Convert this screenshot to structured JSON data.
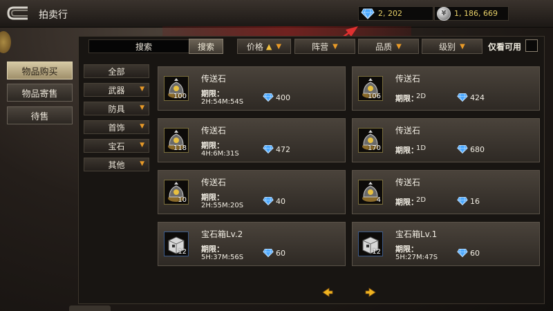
{
  "header": {
    "title": "拍卖行",
    "diamond_balance": "2, 202",
    "silver_balance": "1, 186, 669",
    "silver_coin_glyph": "¥"
  },
  "sidebar": {
    "tabs": [
      {
        "label": "物品购买",
        "active": true
      },
      {
        "label": "物品寄售",
        "active": false
      },
      {
        "label": "待售",
        "active": false
      }
    ]
  },
  "filters": {
    "search_input_value": "搜索",
    "search_button": "搜索",
    "price": "价格",
    "faction": "阵营",
    "quality": "品质",
    "level": "级别",
    "only_usable": "仅看可用"
  },
  "categories": [
    {
      "label": "全部",
      "has_dropdown": false
    },
    {
      "label": "武器",
      "has_dropdown": true
    },
    {
      "label": "防具",
      "has_dropdown": true
    },
    {
      "label": "首饰",
      "has_dropdown": true
    },
    {
      "label": "宝石",
      "has_dropdown": true
    },
    {
      "label": "其他",
      "has_dropdown": true
    }
  ],
  "expiry_label": "期限：",
  "items": [
    {
      "name": "传送石",
      "qty": "100",
      "expiry": "2H:54M:54S",
      "price": "400",
      "icon": "teleport-stone-icon"
    },
    {
      "name": "传送石",
      "qty": "106",
      "expiry": "2D",
      "price": "424",
      "icon": "teleport-stone-icon"
    },
    {
      "name": "传送石",
      "qty": "118",
      "expiry": "4H:6M:31S",
      "price": "472",
      "icon": "teleport-stone-icon"
    },
    {
      "name": "传送石",
      "qty": "170",
      "expiry": "1D",
      "price": "680",
      "icon": "teleport-stone-icon"
    },
    {
      "name": "传送石",
      "qty": "10",
      "expiry": "2H:55M:20S",
      "price": "40",
      "icon": "teleport-stone-icon"
    },
    {
      "name": "传送石",
      "qty": "4",
      "expiry": "2D",
      "price": "16",
      "icon": "teleport-stone-icon"
    },
    {
      "name": "宝石箱Lv.2",
      "qty": "12",
      "expiry": "5H:37M:56S",
      "price": "60",
      "icon": "gem-box-icon"
    },
    {
      "name": "宝石箱Lv.1",
      "qty": "12",
      "expiry": "5H:27M:47S",
      "price": "60",
      "icon": "gem-box-icon"
    }
  ],
  "colors": {
    "accent_gold": "#e8d068",
    "dropdown_chevron": "#e89a28",
    "diamond_blue": "#4aa8ff",
    "annotation_red": "#e03030"
  }
}
